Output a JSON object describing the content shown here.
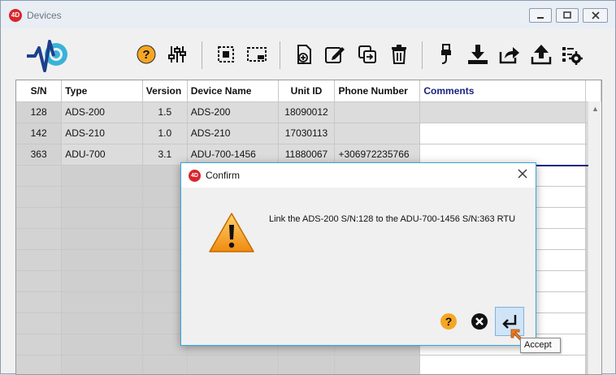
{
  "window": {
    "title": "Devices"
  },
  "toolbar": {
    "icons": [
      "help-icon",
      "settings-sliders-icon",
      "select-all-icon",
      "deselect-icon",
      "add-device-icon",
      "edit-icon",
      "link-icon",
      "delete-icon",
      "usb-connect-icon",
      "download-icon",
      "export-icon",
      "upload-icon",
      "manage-icon"
    ]
  },
  "table": {
    "headers": {
      "sn": "S/N",
      "type": "Type",
      "version": "Version",
      "device_name": "Device Name",
      "unit_id": "Unit ID",
      "phone": "Phone Number",
      "comments": "Comments"
    },
    "rows": [
      {
        "sn": "128",
        "type": "ADS-200",
        "version": "1.5",
        "device_name": "ADS-200",
        "unit_id": "18090012",
        "phone": "",
        "comments": ""
      },
      {
        "sn": "142",
        "type": "ADS-210",
        "version": "1.0",
        "device_name": "ADS-210",
        "unit_id": "17030113",
        "phone": "",
        "comments": ""
      },
      {
        "sn": "363",
        "type": "ADU-700",
        "version": "3.1",
        "device_name": "ADU-700-1456",
        "unit_id": "11880067",
        "phone": "+306972235766",
        "comments": ""
      }
    ]
  },
  "dialog": {
    "title": "Confirm",
    "message": "Link the ADS-200 S/N:128 to the ADU-700-1456 S/N:363 RTU",
    "tooltip": "Accept"
  },
  "colors": {
    "accent": "#39a7d9",
    "help": "#f5a623",
    "brand": "#d9262b"
  }
}
